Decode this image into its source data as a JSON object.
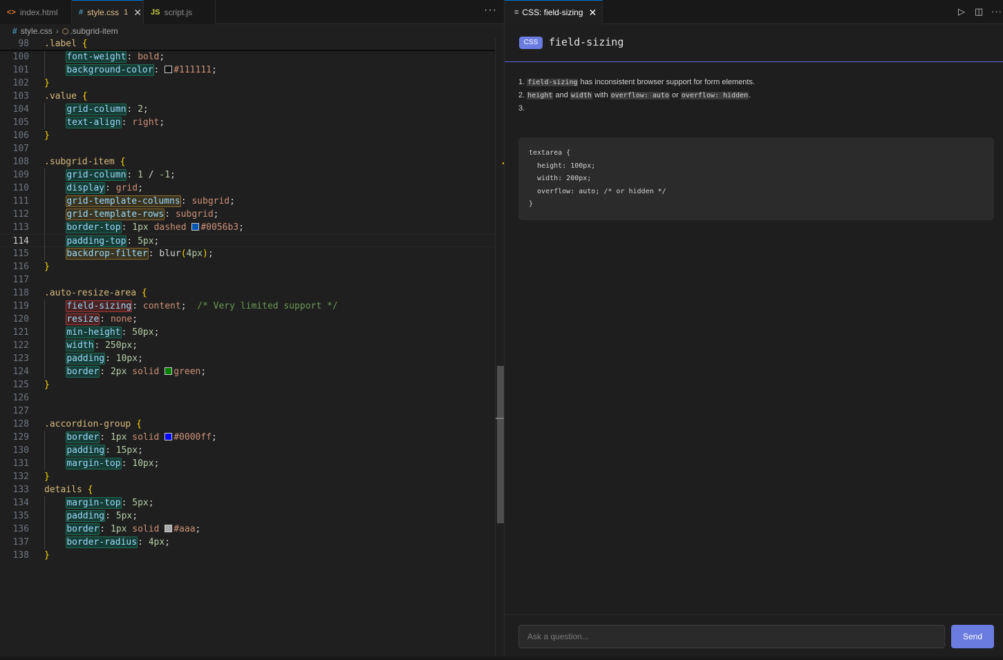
{
  "tabs": [
    {
      "icon": "<>",
      "label": "index.html",
      "active": false
    },
    {
      "icon": "#",
      "label": "style.css",
      "badge": "1",
      "active": true
    },
    {
      "icon": "JS",
      "label": "script.js",
      "active": false
    }
  ],
  "breadcrumb": {
    "file": "style.css",
    "symbol": ".subgrid-item"
  },
  "code": {
    "current_line": 114,
    "lines": [
      {
        "n": 98,
        "t": [
          [
            "sel",
            ".label "
          ],
          [
            "br",
            "{"
          ]
        ]
      },
      {
        "n": 100,
        "t": [
          [
            "ind",
            ""
          ],
          [
            "prop-ok",
            "font-weight"
          ],
          [
            "p",
            ": "
          ],
          [
            "kw",
            "bold"
          ],
          [
            "p",
            ";"
          ]
        ]
      },
      {
        "n": 101,
        "t": [
          [
            "ind",
            ""
          ],
          [
            "prop-ok",
            "background-color"
          ],
          [
            "p",
            ": "
          ],
          [
            "sw",
            "#111111"
          ],
          [
            "kw",
            "#111111"
          ],
          [
            "p",
            ";"
          ]
        ]
      },
      {
        "n": 102,
        "t": [
          [
            "br",
            "}"
          ]
        ]
      },
      {
        "n": 103,
        "t": [
          [
            "sel",
            ".value "
          ],
          [
            "br",
            "{"
          ]
        ]
      },
      {
        "n": 104,
        "t": [
          [
            "ind",
            ""
          ],
          [
            "prop-ok",
            "grid-column"
          ],
          [
            "p",
            ": "
          ],
          [
            "num",
            "2"
          ],
          [
            "p",
            ";"
          ]
        ]
      },
      {
        "n": 105,
        "t": [
          [
            "ind",
            ""
          ],
          [
            "prop-ok",
            "text-align"
          ],
          [
            "p",
            ": "
          ],
          [
            "kw",
            "right"
          ],
          [
            "p",
            ";"
          ]
        ]
      },
      {
        "n": 106,
        "t": [
          [
            "br",
            "}"
          ]
        ]
      },
      {
        "n": 107,
        "t": []
      },
      {
        "n": 108,
        "t": [
          [
            "sel",
            ".subgrid-item "
          ],
          [
            "br",
            "{"
          ]
        ]
      },
      {
        "n": 109,
        "t": [
          [
            "ind",
            ""
          ],
          [
            "prop-ok",
            "grid-column"
          ],
          [
            "p",
            ": "
          ],
          [
            "num",
            "1"
          ],
          [
            "p",
            " / "
          ],
          [
            "num",
            "-1"
          ],
          [
            "p",
            ";"
          ]
        ]
      },
      {
        "n": 110,
        "t": [
          [
            "ind",
            ""
          ],
          [
            "prop-ok",
            "display"
          ],
          [
            "p",
            ": "
          ],
          [
            "kw",
            "grid"
          ],
          [
            "p",
            ";"
          ]
        ]
      },
      {
        "n": 111,
        "t": [
          [
            "ind",
            ""
          ],
          [
            "prop-warn",
            "grid-template-columns"
          ],
          [
            "p",
            ": "
          ],
          [
            "kw",
            "subgrid"
          ],
          [
            "p",
            ";"
          ]
        ]
      },
      {
        "n": 112,
        "t": [
          [
            "ind",
            ""
          ],
          [
            "prop-warn",
            "grid-template-rows"
          ],
          [
            "p",
            ": "
          ],
          [
            "kw",
            "subgrid"
          ],
          [
            "p",
            ";"
          ]
        ]
      },
      {
        "n": 113,
        "t": [
          [
            "ind",
            ""
          ],
          [
            "prop-ok",
            "border-top"
          ],
          [
            "p",
            ": "
          ],
          [
            "num",
            "1px"
          ],
          [
            "p",
            " "
          ],
          [
            "kw",
            "dashed"
          ],
          [
            "p",
            " "
          ],
          [
            "sw",
            "#0056b3"
          ],
          [
            "kw",
            "#0056b3"
          ],
          [
            "p",
            ";"
          ]
        ]
      },
      {
        "n": 114,
        "t": [
          [
            "ind",
            ""
          ],
          [
            "prop-ok",
            "padding-top"
          ],
          [
            "p",
            ": "
          ],
          [
            "num",
            "5px"
          ],
          [
            "p",
            ";"
          ]
        ]
      },
      {
        "n": 115,
        "t": [
          [
            "ind",
            ""
          ],
          [
            "prop-warn",
            "backdrop-filter"
          ],
          [
            "p",
            ": "
          ],
          [
            "p",
            "blur"
          ],
          [
            "br",
            "("
          ],
          [
            "num",
            "4px"
          ],
          [
            "br",
            ")"
          ],
          [
            "p",
            ";"
          ]
        ]
      },
      {
        "n": 116,
        "t": [
          [
            "br",
            "}"
          ]
        ]
      },
      {
        "n": 117,
        "t": []
      },
      {
        "n": 118,
        "t": [
          [
            "sel",
            ".auto-resize-area "
          ],
          [
            "br",
            "{"
          ]
        ]
      },
      {
        "n": 119,
        "t": [
          [
            "ind",
            ""
          ],
          [
            "prop-bad",
            "field-sizing"
          ],
          [
            "p",
            ": "
          ],
          [
            "kw",
            "content"
          ],
          [
            "p",
            ";  "
          ],
          [
            "cmt",
            "/* Very limited support */"
          ]
        ]
      },
      {
        "n": 120,
        "t": [
          [
            "ind",
            ""
          ],
          [
            "prop-bad",
            "resize"
          ],
          [
            "p",
            ": "
          ],
          [
            "kw",
            "none"
          ],
          [
            "p",
            ";"
          ]
        ]
      },
      {
        "n": 121,
        "t": [
          [
            "ind",
            ""
          ],
          [
            "prop-ok",
            "min-height"
          ],
          [
            "p",
            ": "
          ],
          [
            "num",
            "50px"
          ],
          [
            "p",
            ";"
          ]
        ]
      },
      {
        "n": 122,
        "t": [
          [
            "ind",
            ""
          ],
          [
            "prop-ok",
            "width"
          ],
          [
            "p",
            ": "
          ],
          [
            "num",
            "250px"
          ],
          [
            "p",
            ";"
          ]
        ]
      },
      {
        "n": 123,
        "t": [
          [
            "ind",
            ""
          ],
          [
            "prop-ok",
            "padding"
          ],
          [
            "p",
            ": "
          ],
          [
            "num",
            "10px"
          ],
          [
            "p",
            ";"
          ]
        ]
      },
      {
        "n": 124,
        "t": [
          [
            "ind",
            ""
          ],
          [
            "prop-ok",
            "border"
          ],
          [
            "p",
            ": "
          ],
          [
            "num",
            "2px"
          ],
          [
            "p",
            " "
          ],
          [
            "kw",
            "solid"
          ],
          [
            "p",
            " "
          ],
          [
            "sw",
            "#008000"
          ],
          [
            "kw",
            "green"
          ],
          [
            "p",
            ";"
          ]
        ]
      },
      {
        "n": 125,
        "t": [
          [
            "br",
            "}"
          ]
        ]
      },
      {
        "n": 126,
        "t": []
      },
      {
        "n": 127,
        "t": []
      },
      {
        "n": 128,
        "t": [
          [
            "sel",
            ".accordion-group "
          ],
          [
            "br",
            "{"
          ]
        ]
      },
      {
        "n": 129,
        "t": [
          [
            "ind",
            ""
          ],
          [
            "prop-ok",
            "border"
          ],
          [
            "p",
            ": "
          ],
          [
            "num",
            "1px"
          ],
          [
            "p",
            " "
          ],
          [
            "kw",
            "solid"
          ],
          [
            "p",
            " "
          ],
          [
            "sw",
            "#0000ff"
          ],
          [
            "kw",
            "#0000ff"
          ],
          [
            "p",
            ";"
          ]
        ]
      },
      {
        "n": 130,
        "t": [
          [
            "ind",
            ""
          ],
          [
            "prop-ok",
            "padding"
          ],
          [
            "p",
            ": "
          ],
          [
            "num",
            "15px"
          ],
          [
            "p",
            ";"
          ]
        ]
      },
      {
        "n": 131,
        "t": [
          [
            "ind",
            ""
          ],
          [
            "prop-ok",
            "margin-top"
          ],
          [
            "p",
            ": "
          ],
          [
            "num",
            "10px"
          ],
          [
            "p",
            ";"
          ]
        ]
      },
      {
        "n": 132,
        "t": [
          [
            "br",
            "}"
          ]
        ]
      },
      {
        "n": 133,
        "t": [
          [
            "sel",
            "details "
          ],
          [
            "br",
            "{"
          ]
        ]
      },
      {
        "n": 134,
        "t": [
          [
            "ind",
            ""
          ],
          [
            "prop-ok",
            "margin-top"
          ],
          [
            "p",
            ": "
          ],
          [
            "num",
            "5px"
          ],
          [
            "p",
            ";"
          ]
        ]
      },
      {
        "n": 135,
        "t": [
          [
            "ind",
            ""
          ],
          [
            "prop-ok",
            "padding"
          ],
          [
            "p",
            ": "
          ],
          [
            "num",
            "5px"
          ],
          [
            "p",
            ";"
          ]
        ]
      },
      {
        "n": 136,
        "t": [
          [
            "ind",
            ""
          ],
          [
            "prop-ok",
            "border"
          ],
          [
            "p",
            ": "
          ],
          [
            "num",
            "1px"
          ],
          [
            "p",
            " "
          ],
          [
            "kw",
            "solid"
          ],
          [
            "p",
            " "
          ],
          [
            "sw",
            "#aaaaaa"
          ],
          [
            "kw",
            "#aaa"
          ],
          [
            "p",
            ";"
          ]
        ]
      },
      {
        "n": 137,
        "t": [
          [
            "ind",
            ""
          ],
          [
            "prop-ok",
            "border-radius"
          ],
          [
            "p",
            ": "
          ],
          [
            "num",
            "4px"
          ],
          [
            "p",
            ";"
          ]
        ]
      },
      {
        "n": 138,
        "t": [
          [
            "br",
            "}"
          ]
        ]
      }
    ]
  },
  "panel": {
    "tab_label": "CSS: field-sizing",
    "badge": "CSS",
    "title": "field-sizing",
    "notes": [
      [
        [
          "n",
          "1. "
        ],
        [
          "c",
          "field-sizing"
        ],
        [
          "t",
          " has inconsistent browser support for form elements."
        ]
      ],
      [
        [
          "n",
          "2. "
        ],
        [
          "c",
          "height"
        ],
        [
          "t",
          " and "
        ],
        [
          "c",
          "width"
        ],
        [
          "t",
          " with "
        ],
        [
          "c",
          "overflow: auto"
        ],
        [
          "t",
          " or "
        ],
        [
          "c",
          "overflow: hidden"
        ],
        [
          "t",
          "."
        ]
      ],
      [
        [
          "n",
          "3."
        ]
      ]
    ],
    "code_example": "textarea {\n  height: 100px;\n  width: 200px;\n  overflow: auto; /* or hidden */\n}",
    "ask_placeholder": "Ask a question...",
    "send_label": "Send"
  },
  "colors": {
    "accent": "#6b7ce0",
    "active_tab_border": "#0078d4"
  }
}
